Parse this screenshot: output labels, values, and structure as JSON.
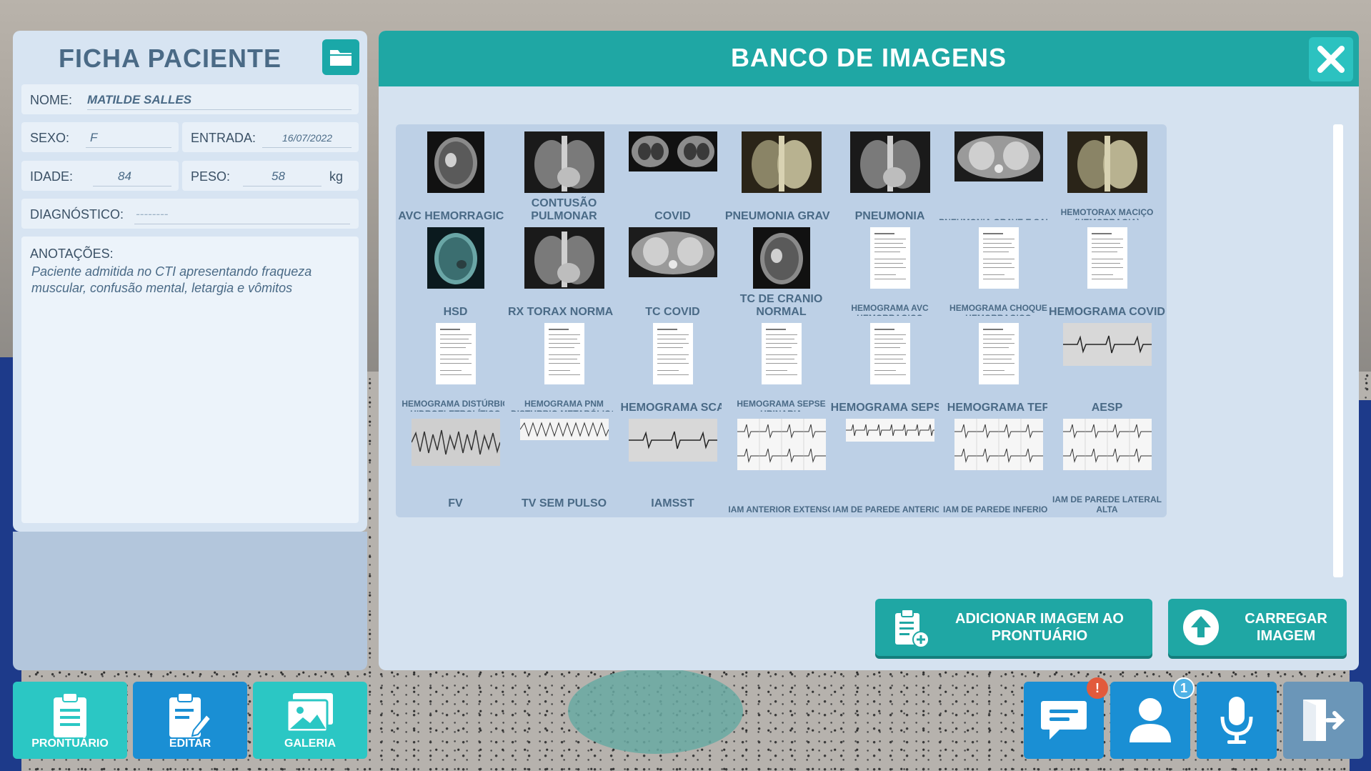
{
  "ficha": {
    "title": "FICHA PACIENTE",
    "nome_label": "NOME:",
    "nome_value": "MATILDE SALLES",
    "sexo_label": "SEXO:",
    "sexo_value": "F",
    "entrada_label": "ENTRADA:",
    "entrada_value": "16/07/2022",
    "idade_label": "IDADE:",
    "idade_value": "84",
    "peso_label": "PESO:",
    "peso_value": "58",
    "peso_unit": "kg",
    "diagnostico_label": "DIAGNÓSTICO:",
    "diagnostico_value": "--------",
    "anotacoes_label": "ANOTAÇÕES:",
    "anotacoes_text": "Paciente admitida no CTI apresentando fraqueza muscular, confusão mental, letargia e vômitos"
  },
  "banco": {
    "title": "BANCO DE IMAGENS",
    "tiles": [
      {
        "label": "AVC HEMORRAGICO",
        "kind": "ct"
      },
      {
        "label": "CONTUSÃO PULMONAR",
        "kind": "xray"
      },
      {
        "label": "COVID",
        "kind": "ct-pair"
      },
      {
        "label": "PNEUMONIA GRAVE",
        "kind": "xray-sepia"
      },
      {
        "label": "PNEUMONIA",
        "kind": "xray"
      },
      {
        "label": "PNEUMONIA GRAVE E SARA",
        "kind": "ct-wide"
      },
      {
        "label": "HEMOTORAX MACIÇO (HEMORRAGIA)",
        "kind": "xray-sepia"
      },
      {
        "label": "HSD",
        "kind": "ct-teal"
      },
      {
        "label": "RX TORAX NORMAL",
        "kind": "xray"
      },
      {
        "label": "TC COVID",
        "kind": "ct-wide"
      },
      {
        "label": "TC DE CRANIO NORMAL",
        "kind": "ct"
      },
      {
        "label": "HEMOGRAMA AVC HEMORRAGICO",
        "kind": "doc"
      },
      {
        "label": "HEMOGRAMA CHOQUE HEMORRAGICO",
        "kind": "doc"
      },
      {
        "label": "HEMOGRAMA COVID",
        "kind": "doc"
      },
      {
        "label": "HEMOGRAMA DISTÚRBIO HIDROELETROLÍTICO",
        "kind": "doc"
      },
      {
        "label": "HEMOGRAMA PNM DISTURBIO METABÓLICO",
        "kind": "doc"
      },
      {
        "label": "HEMOGRAMA SCA",
        "kind": "doc"
      },
      {
        "label": "HEMOGRAMA SEPSE URINARIA",
        "kind": "doc"
      },
      {
        "label": "HEMOGRAMA SEPSE",
        "kind": "doc"
      },
      {
        "label": "HEMOGRAMA TEP",
        "kind": "doc"
      },
      {
        "label": "AESP",
        "kind": "ecg-strip"
      },
      {
        "label": "FV",
        "kind": "ecg-fv"
      },
      {
        "label": "TV SEM PULSO",
        "kind": "ecg-tv"
      },
      {
        "label": "IAMSST",
        "kind": "ecg-strip"
      },
      {
        "label": "IAM ANTERIOR EXTENSO",
        "kind": "ecg-12"
      },
      {
        "label": "IAM DE PAREDE ANTERIOR",
        "kind": "ecg-long"
      },
      {
        "label": "IAM DE PAREDE INFERIOR",
        "kind": "ecg-12"
      },
      {
        "label": "IAM DE PAREDE LATERAL ALTA",
        "kind": "ecg-12"
      }
    ],
    "add_button": "ADICIONAR IMAGEM AO PRONTUÁRIO",
    "upload_button": "CARREGAR IMAGEM"
  },
  "tabs": {
    "prontuario": "PRONTUÁRIO",
    "editar": "EDITAR",
    "galeria": "GALERIA"
  },
  "badges": {
    "chat": "!",
    "patient": "1"
  },
  "colors": {
    "teal": "#1fa7a4",
    "teal_light": "#2cc2c0",
    "blue_button": "#1a8fd4",
    "panel_bg": "#d5e2f0",
    "tile_bg": "#bdd0e6",
    "text_dark": "#4a6a86"
  },
  "icons": [
    "folder-icon",
    "close-icon",
    "clipboard-add-icon",
    "upload-icon",
    "clipboard-icon",
    "edit-icon",
    "gallery-icon",
    "chat-icon",
    "user-icon",
    "microphone-icon",
    "exit-icon"
  ]
}
